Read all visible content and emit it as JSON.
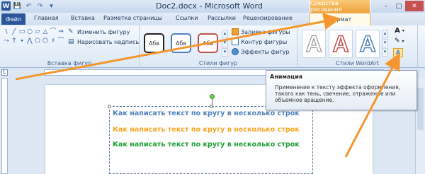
{
  "titlebar": {
    "title": "Doc2.docx - Microsoft Word",
    "context_header": "Средства рисования",
    "logo": "W"
  },
  "qat": {
    "save_icon": "💾",
    "undo_icon": "↶",
    "redo_icon": "↷",
    "customize_icon": "▾"
  },
  "window": {
    "minimize": "–",
    "maximize": "□",
    "close": "✕"
  },
  "tabs": {
    "file": "Файл",
    "home": "Главная",
    "insert": "Вставка",
    "layout": "Разметка страницы",
    "references": "Ссылки",
    "mailings": "Рассылки",
    "review": "Рецензирование",
    "format": "Формат"
  },
  "ribbon": {
    "insert_shapes": {
      "label": "Вставка фигур",
      "edit_shape": "Изменить фигуру",
      "draw_textbox": "Нарисовать надпись",
      "shapes": [
        "\\",
        "╱",
        "▭",
        "○",
        "▱",
        "△",
        "⌒",
        "⇒",
        "⤳",
        "↑",
        "∙",
        "⋀",
        "⬠",
        "⬡",
        "♯",
        "⌒"
      ]
    },
    "shape_styles": {
      "label": "Стили фигур",
      "boxes": [
        "Абв",
        "Абв",
        "Абв"
      ],
      "fill": "Заливка фигуры",
      "outline": "Контур фигуры",
      "effects": "Эффекты фигур"
    },
    "wordart_styles": {
      "label": "Стили WordArt",
      "letters": [
        "A",
        "A",
        "A"
      ],
      "text_fill_icon": "A",
      "effects_icon": "A"
    }
  },
  "tooltip": {
    "title": "Анимация",
    "body": "Применение к тексту эффекта оформления, такого как тень, свечение, отражение или объемное вращение."
  },
  "document": {
    "lines": [
      {
        "text": "Как написать текст по кругу в несколько строк",
        "color": "#4f81bd"
      },
      {
        "text": "Как написать текст по кругу в несколько строк",
        "color": "#f7a623"
      },
      {
        "text": "Как написать текст по кругу в несколько строк",
        "color": "#1ea035"
      }
    ]
  },
  "colors": {
    "accent_orange": "#f3962e",
    "file_blue": "#2b579a"
  }
}
